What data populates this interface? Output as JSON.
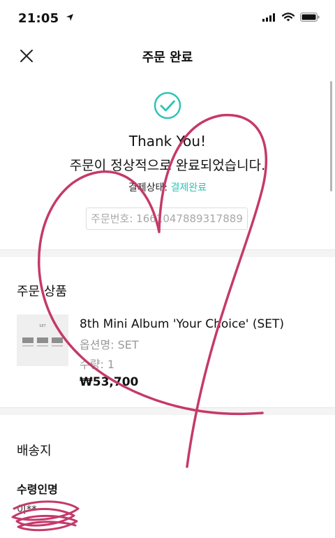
{
  "status_bar": {
    "time": "21:05"
  },
  "header": {
    "title": "주문 완료"
  },
  "confirmation": {
    "thank_you": "Thank You!",
    "message": "주문이 정상적으로 완료되었습니다.",
    "payment_status_label": "결제상태:",
    "payment_status_value": "결제완료",
    "order_number": "주문번호: 1661047889317889"
  },
  "order_items": {
    "section_title": "주문 상품",
    "items": [
      {
        "thumb_label": "SET",
        "name": "8th Mini Album 'Your Choice' (SET)",
        "option": "옵션명: SET",
        "quantity": "수량: 1",
        "price": "₩53,700"
      }
    ]
  },
  "shipping": {
    "section_title": "배송지",
    "recipient_label": "수령인명",
    "recipient_name": "이**"
  },
  "colors": {
    "accent": "#2ec4b6",
    "annotation": "#c43a6a"
  }
}
